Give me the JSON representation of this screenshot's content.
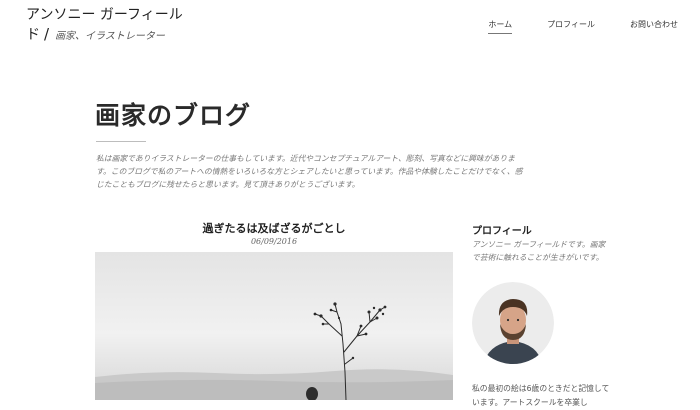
{
  "site": {
    "title_line1": "アンソニー ガーフィール",
    "title_line2": "ド",
    "tagline": "画家、イラストレーター"
  },
  "nav": {
    "items": [
      {
        "label": "ホーム"
      },
      {
        "label": "プロフィール"
      },
      {
        "label": "お問い合わせ"
      }
    ]
  },
  "page": {
    "title": "画家のブログ",
    "intro": "私は画家でありイラストレーターの仕事もしています。近代やコンセプチュアルアート、彫刻、写真などに興味があります。このブログで私のアートへの情熱をいろいろな方とシェアしたいと思っています。作品や体験したことだけでなく、感じたこともブログに残せたらと思います。見て頂きありがとうございます。"
  },
  "post": {
    "title": "過ぎたるは及ばざるがごとし",
    "date": "06/09/2016"
  },
  "sidebar": {
    "heading": "プロフィール",
    "text": "アンソニー ガーフィールドです。画家で芸術に触れることが生きがいです。",
    "bio": "私の最初の絵は6歳のときだと記憶しています。アートスクールを卒業し"
  }
}
